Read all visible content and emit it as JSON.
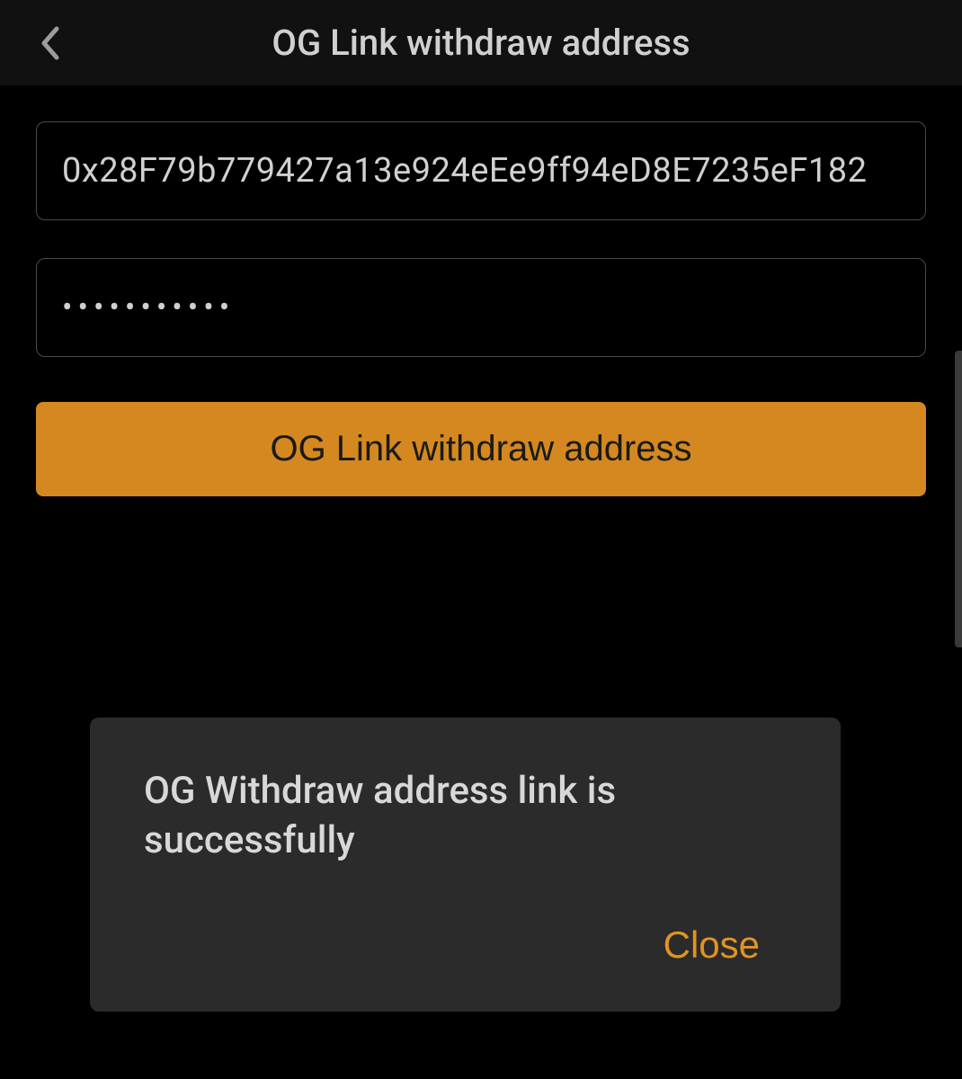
{
  "header": {
    "title": "OG Link withdraw address"
  },
  "form": {
    "address_value": "0x28F79b779427a13e924eEe9ff94eD8E7235eF182",
    "password_value": "•••••••••••",
    "submit_label": "OG Link withdraw address"
  },
  "dialog": {
    "message": "OG Withdraw address link is successfully",
    "close_label": "Close"
  },
  "colors": {
    "accent": "#d4881f",
    "dialog_bg": "#2b2b2b",
    "text_muted": "#d0d0d0"
  }
}
